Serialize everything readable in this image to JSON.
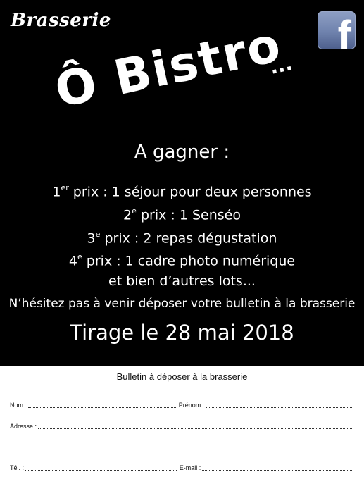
{
  "header": {
    "brand": "Brasserie",
    "facebook_icon": "facebook-icon"
  },
  "logo": {
    "text": "Ô Bistro",
    "dots": "..."
  },
  "contest": {
    "heading": "A gagner :",
    "prizes": [
      {
        "num": "1",
        "sup": "er",
        "text": " prix : 1 séjour pour deux personnes"
      },
      {
        "num": "2",
        "sup": "e",
        "text": " prix : 1 Senséo"
      },
      {
        "num": "3",
        "sup": "e",
        "text": " prix : 2 repas dégustation"
      },
      {
        "num": "4",
        "sup": "e",
        "text": " prix : 1 cadre photo numérique"
      }
    ],
    "others": "et bien d’autres lots...",
    "invite": "N’hésitez pas à venir déposer votre bulletin à la brasserie",
    "draw": "Tirage le 28 mai 2018"
  },
  "form": {
    "title": "Bulletin à déposer à la brasserie",
    "nom_label": "Nom :",
    "prenom_label": "Prénom :",
    "adresse_label": "Adresse :",
    "tel_label": "Tél. :",
    "email_label": "E-mail :"
  },
  "colors": {
    "background": "#000000",
    "text": "#ffffff",
    "facebook": "#6f82ad"
  }
}
